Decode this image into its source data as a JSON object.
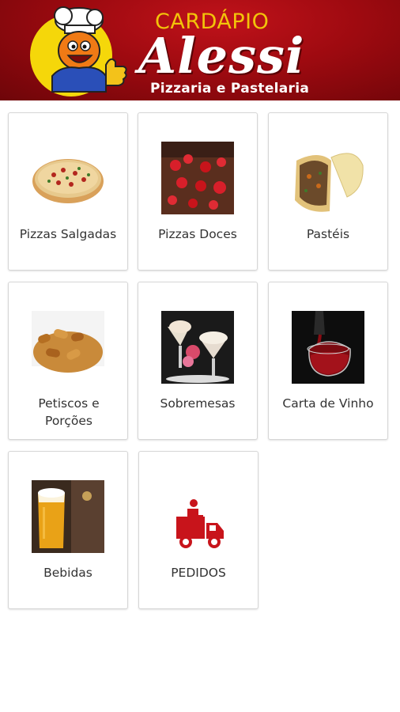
{
  "header": {
    "brand_top": "CARDÁPIO",
    "brand_name": "Alessi",
    "brand_sub": "Pizzaria e Pastelaria"
  },
  "menu": {
    "items": [
      {
        "label": "Pizzas Salgadas",
        "icon": "pizza-salgada-photo"
      },
      {
        "label": "Pizzas Doces",
        "icon": "pizza-doce-photo"
      },
      {
        "label": "Pastéis",
        "icon": "pastel-photo"
      },
      {
        "label": "Petiscos e Porções",
        "icon": "petiscos-photo"
      },
      {
        "label": "Sobremesas",
        "icon": "sobremesa-photo"
      },
      {
        "label": "Carta de Vinho",
        "icon": "wine-photo"
      },
      {
        "label": "Bebidas",
        "icon": "beer-photo"
      },
      {
        "label": "PEDIDOS",
        "icon": "delivery-truck-icon"
      }
    ]
  },
  "colors": {
    "header_red": "#a00b12",
    "brand_gold": "#f2c30a",
    "truck_red": "#c8141b"
  }
}
